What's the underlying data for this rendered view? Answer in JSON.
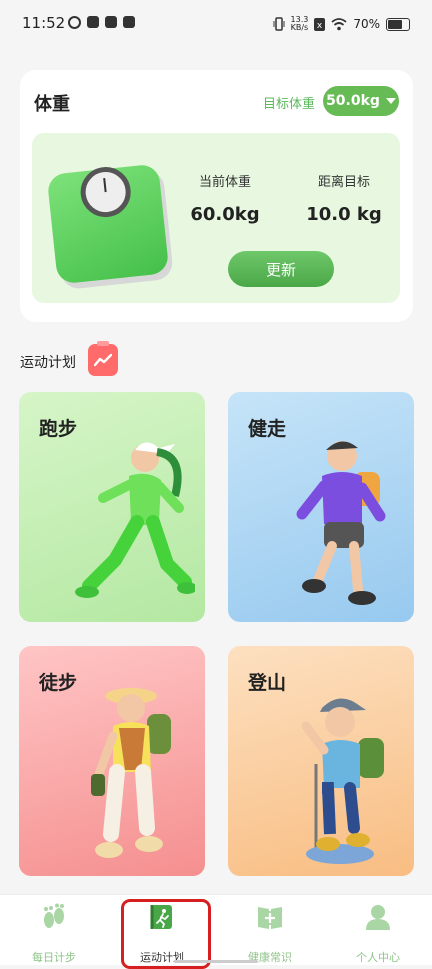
{
  "status_bar": {
    "time": "11:52",
    "net_speed_value": "13.3",
    "net_speed_unit": "KB/s",
    "battery_percent": "70%"
  },
  "weight": {
    "title": "体重",
    "target_label": "目标体重",
    "target_value": "50.0kg",
    "current_label": "当前体重",
    "current_value": "60.0kg",
    "distance_label": "距离目标",
    "distance_value": "10.0 kg",
    "update_label": "更新"
  },
  "plan": {
    "section_title": "运动计划",
    "activities": [
      {
        "label": "跑步",
        "color": "#b4e8a2"
      },
      {
        "label": "健走",
        "color": "#97c9ef"
      },
      {
        "label": "徒步",
        "color": "#f58f8f"
      },
      {
        "label": "登山",
        "color": "#f8bd82"
      }
    ]
  },
  "tabs": [
    {
      "label": "每日计步",
      "icon": "footprint-icon"
    },
    {
      "label": "运动计划",
      "icon": "running-plan-icon"
    },
    {
      "label": "健康常识",
      "icon": "health-book-icon"
    },
    {
      "label": "个人中心",
      "icon": "person-icon"
    }
  ],
  "colors": {
    "accent": "#66bb55",
    "highlight": "#d62020"
  }
}
